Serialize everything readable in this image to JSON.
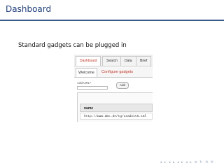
{
  "frame": {
    "title": "Dashboard",
    "text": "Standard gadgets can be plugged in"
  },
  "screenshot": {
    "tabs": [
      "Dashboard",
      "Search",
      "Data",
      "Brief"
    ],
    "active_tab": "Dashboard",
    "subtabs": [
      "Welcome",
      "Configure gadgets"
    ],
    "active_subtab": "Configure gadgets",
    "add_url_label": "Add URL*",
    "add_button": "Add",
    "table_header": "name",
    "table_value": "http://www.dmc.de/tg/LeadIct5.xml"
  },
  "navigation": {
    "glyphs": "◂ ▸ ◂ ▸ ◂ ▸ ◂ ▸  ≡  ↻ ⟲ ⟳"
  },
  "colors": {
    "title": "#1f3f7a",
    "active_tab": "#c0392b",
    "nav": "#9aa7bd"
  }
}
